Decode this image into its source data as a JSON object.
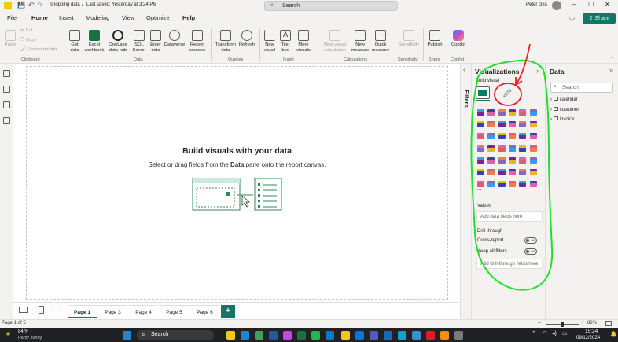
{
  "titlebar": {
    "file_label": "shopping data",
    "saved_label": "Last saved: Yesterday at 3:24 PM",
    "search_placeholder": "Search",
    "user_name": "Peter ciya"
  },
  "menu": [
    "File",
    "Home",
    "Insert",
    "Modeling",
    "View",
    "Optimize",
    "Help"
  ],
  "share_label": "Share",
  "ribbon": {
    "clipboard": {
      "paste": "Paste",
      "cut": "Cut",
      "copy": "Copy",
      "format_painter": "Format painter",
      "group": "Clipboard"
    },
    "data": {
      "get_data": "Get data",
      "excel": "Excel workbook",
      "onelake": "OneLake data hub",
      "sql": "SQL Server",
      "enter": "Enter data",
      "dataverse": "Dataverse",
      "recent": "Recent sources",
      "group": "Data"
    },
    "queries": {
      "transform": "Transform data",
      "refresh": "Refresh",
      "group": "Queries"
    },
    "insert": {
      "new_visual": "New visual",
      "text_box": "Text box",
      "more_visuals": "More visuals",
      "group": "Insert"
    },
    "calculations": {
      "new_visual_calc": "New visual calculation",
      "new_measure": "New measure",
      "quick_measure": "Quick measure",
      "group": "Calculations"
    },
    "sensitivity": {
      "label": "Sensitivity",
      "group": "Sensitivity"
    },
    "share": {
      "publish": "Publish",
      "group": "Share"
    },
    "copilot": {
      "label": "Copilot",
      "group": "Copilot"
    }
  },
  "canvas": {
    "title": "Build visuals with your data",
    "subtitle_pre": "Select or drag fields from the ",
    "subtitle_bold": "Data",
    "subtitle_post": " pane onto the report canvas."
  },
  "filters_label": "Filters",
  "visualizations": {
    "title": "Visualizations",
    "build_visual": "Build visual",
    "values_label": "Values",
    "values_field": "Add data fields here",
    "drill_through": "Drill through",
    "cross_report": "Cross-report",
    "cross_report_state": "Off",
    "keep_all_filters": "Keep all filters",
    "keep_all_filters_state": "Off",
    "drill_field": "Add drill-through fields here",
    "more": "..."
  },
  "data_pane": {
    "title": "Data",
    "search_placeholder": "Search",
    "tables": [
      "calendar",
      "customer",
      "invoice"
    ]
  },
  "pages": [
    "Page 1",
    "Page 3",
    "Page 4",
    "Page 5",
    "Page 6"
  ],
  "add_page": "+",
  "status": {
    "page_indicator": "Page 1 of 5",
    "zoom": "82%"
  },
  "taskbar": {
    "weather_temp": "84°F",
    "weather_desc": "Partly sunny",
    "search": "Search",
    "time": "15:24",
    "date": "09/12/2024"
  },
  "colors": {
    "accent": "#117865",
    "annotation_green": "#22e02a",
    "annotation_red": "#e8202a"
  }
}
